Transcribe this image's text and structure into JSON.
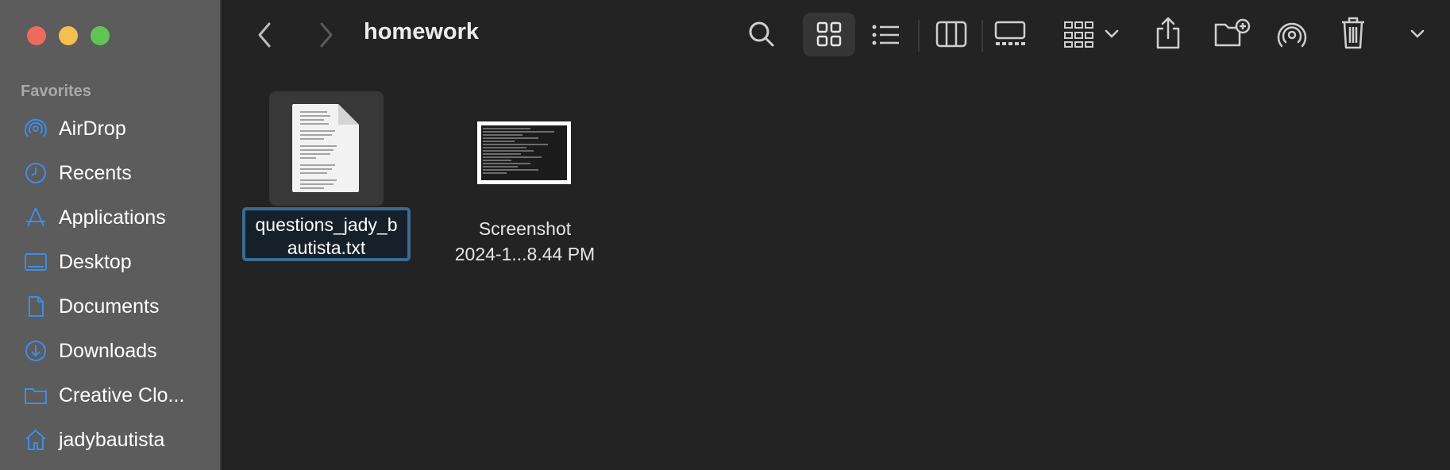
{
  "window": {
    "title": "homework"
  },
  "sidebar": {
    "section_title": "Favorites",
    "items": [
      {
        "label": "AirDrop",
        "icon": "airdrop-icon"
      },
      {
        "label": "Recents",
        "icon": "clock-icon"
      },
      {
        "label": "Applications",
        "icon": "applications-icon"
      },
      {
        "label": "Desktop",
        "icon": "desktop-icon"
      },
      {
        "label": "Documents",
        "icon": "document-icon"
      },
      {
        "label": "Downloads",
        "icon": "download-icon"
      },
      {
        "label": "Creative Clo...",
        "icon": "folder-icon"
      },
      {
        "label": "jadybautista",
        "icon": "home-icon"
      }
    ]
  },
  "toolbar": {
    "icons": [
      "back-icon",
      "forward-icon",
      "search-icon",
      "grid-view-icon",
      "list-view-icon",
      "column-view-icon",
      "gallery-view-icon",
      "group-icon",
      "share-icon",
      "new-folder-icon",
      "airdrop-icon",
      "trash-icon",
      "more-icon"
    ]
  },
  "files": [
    {
      "name": "questions_jady_b\nautista.txt",
      "kind": "text-document",
      "selected": true
    },
    {
      "name": "Screenshot\n2024-1...8.44 PM",
      "kind": "image",
      "selected": false
    }
  ],
  "colors": {
    "sidebar_bg": "#5c5c5c",
    "main_bg": "#232323",
    "accent": "#3b8ee8",
    "selection_border": "#3b6a92"
  }
}
